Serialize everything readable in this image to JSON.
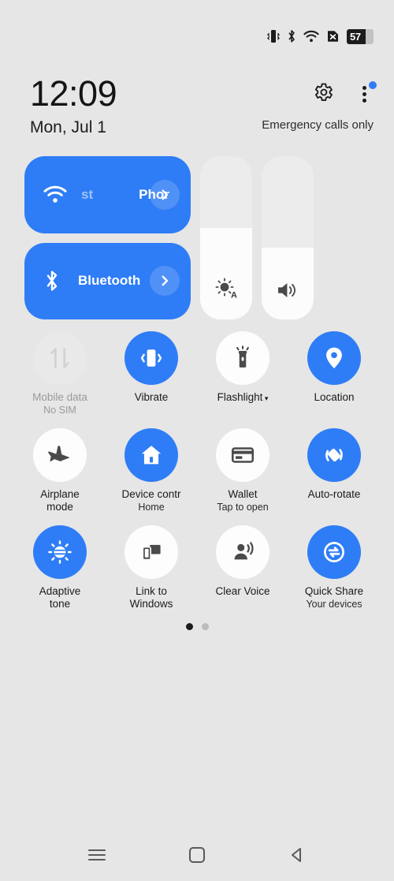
{
  "status_bar": {
    "icons": [
      "vibrate-icon",
      "bluetooth-icon",
      "wifi-icon",
      "no-sim-icon"
    ],
    "battery_percent": "57",
    "battery_fill_pct": 70
  },
  "header": {
    "time": "12:09",
    "date": "Mon, Jul 1",
    "carrier_status": "Emergency calls only",
    "settings_icon": "gear-icon",
    "menu_icon": "three-dot-menu-icon",
    "menu_has_badge": true
  },
  "top_tiles": {
    "wifi": {
      "label_head": "st",
      "label_tail": "Phor",
      "icon": "wifi-icon",
      "active": true,
      "expand_icon": "chevron-right-icon"
    },
    "bluetooth": {
      "label": "Bluetooth",
      "icon": "bluetooth-icon",
      "active": true,
      "expand_icon": "chevron-right-icon"
    },
    "brightness": {
      "icon": "brightness-auto-icon",
      "fill_pct": 56,
      "auto_badge": "A"
    },
    "volume": {
      "icon": "volume-icon",
      "fill_pct": 44
    }
  },
  "tiles": [
    {
      "name": "mobile-data",
      "label": "Mobile data",
      "sub": "No SIM",
      "state": "disabled",
      "icon": "data-transfer-icon"
    },
    {
      "name": "vibrate",
      "label": "Vibrate",
      "sub": "",
      "state": "on",
      "icon": "vibrate-icon"
    },
    {
      "name": "flashlight",
      "label": "Flashlight",
      "sub": "",
      "state": "off",
      "icon": "flashlight-icon",
      "caret": "▾"
    },
    {
      "name": "location",
      "label": "Location",
      "sub": "",
      "state": "on",
      "icon": "location-pin-icon"
    },
    {
      "name": "airplane-mode",
      "label": "Airplane\nmode",
      "sub": "",
      "state": "off",
      "icon": "airplane-icon"
    },
    {
      "name": "device-control",
      "label": "Device contr",
      "sub": "Home",
      "state": "on",
      "icon": "home-icon",
      "clip": true
    },
    {
      "name": "wallet",
      "label": "Wallet",
      "sub": "Tap to open",
      "state": "off",
      "icon": "credit-card-icon"
    },
    {
      "name": "auto-rotate",
      "label": "Auto-rotate",
      "sub": "",
      "state": "on",
      "icon": "auto-rotate-icon"
    },
    {
      "name": "adaptive-tone",
      "label": "Adaptive\ntone",
      "sub": "",
      "state": "on",
      "icon": "adaptive-tone-icon"
    },
    {
      "name": "link-to-windows",
      "label": "Link to\nWindows",
      "sub": "",
      "state": "off",
      "icon": "link-to-windows-icon"
    },
    {
      "name": "clear-voice",
      "label": "Clear Voice",
      "sub": "",
      "state": "off",
      "icon": "clear-voice-icon"
    },
    {
      "name": "quick-share",
      "label": "Quick Share",
      "sub": "Your devices",
      "state": "on",
      "icon": "quick-share-icon"
    }
  ],
  "pagination": {
    "total": 2,
    "active_index": 0
  },
  "nav_bar": {
    "recents_label": "recents-icon",
    "home_label": "home-icon",
    "back_label": "back-icon"
  },
  "colors": {
    "accent": "#2f7df6",
    "background": "#e6e6e6",
    "tile_off": "#fdfdfd",
    "tile_disabled": "#e9e9e9"
  }
}
